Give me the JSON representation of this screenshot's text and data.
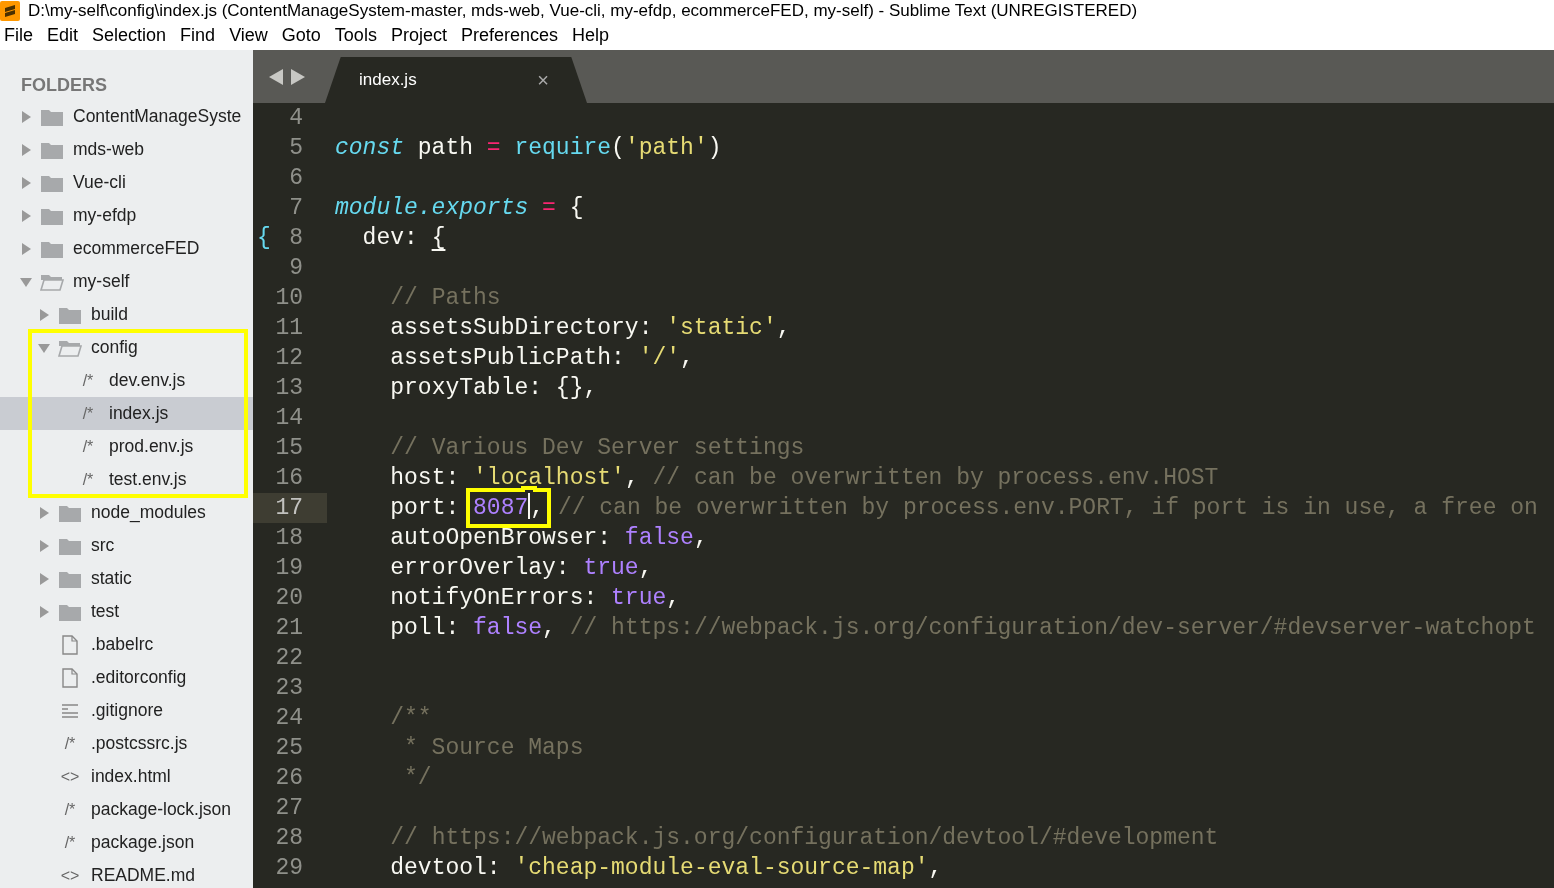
{
  "window": {
    "title": "D:\\my-self\\config\\index.js (ContentManageSystem-master, mds-web, Vue-cli, my-efdp, ecommerceFED, my-self) - Sublime Text (UNREGISTERED)"
  },
  "menu": [
    "File",
    "Edit",
    "Selection",
    "Find",
    "View",
    "Goto",
    "Tools",
    "Project",
    "Preferences",
    "Help"
  ],
  "sidebar": {
    "heading": "FOLDERS",
    "items": [
      {
        "label": "ContentManageSyste",
        "kind": "folder",
        "expanded": false,
        "selected": false
      },
      {
        "label": "mds-web",
        "kind": "folder",
        "expanded": false,
        "selected": false
      },
      {
        "label": "Vue-cli",
        "kind": "folder",
        "expanded": false,
        "selected": false
      },
      {
        "label": "my-efdp",
        "kind": "folder",
        "expanded": false,
        "selected": false
      },
      {
        "label": "ecommerceFED",
        "kind": "folder",
        "expanded": false,
        "selected": false
      },
      {
        "label": "my-self",
        "kind": "folder",
        "expanded": true,
        "selected": false,
        "children": [
          {
            "label": "build",
            "kind": "folder",
            "expanded": false,
            "selected": false
          },
          {
            "label": "config",
            "kind": "folder",
            "expanded": true,
            "selected": false,
            "boxed": true,
            "children": [
              {
                "label": "dev.env.js",
                "kind": "glyph",
                "glyph": "/*",
                "selected": false
              },
              {
                "label": "index.js",
                "kind": "glyph",
                "glyph": "/*",
                "selected": true
              },
              {
                "label": "prod.env.js",
                "kind": "glyph",
                "glyph": "/*",
                "selected": false
              },
              {
                "label": "test.env.js",
                "kind": "glyph",
                "glyph": "/*",
                "selected": false
              }
            ]
          },
          {
            "label": "node_modules",
            "kind": "folder",
            "expanded": false,
            "selected": false
          },
          {
            "label": "src",
            "kind": "folder",
            "expanded": false,
            "selected": false
          },
          {
            "label": "static",
            "kind": "folder",
            "expanded": false,
            "selected": false
          },
          {
            "label": "test",
            "kind": "folder",
            "expanded": false,
            "selected": false
          },
          {
            "label": ".babelrc",
            "kind": "doc",
            "selected": false
          },
          {
            "label": ".editorconfig",
            "kind": "doc",
            "selected": false
          },
          {
            "label": ".gitignore",
            "kind": "lines",
            "selected": false
          },
          {
            "label": ".postcssrc.js",
            "kind": "glyph",
            "glyph": "/*",
            "selected": false
          },
          {
            "label": "index.html",
            "kind": "glyph",
            "glyph": "<>",
            "selected": false
          },
          {
            "label": "package-lock.json",
            "kind": "glyph",
            "glyph": "/*",
            "selected": false
          },
          {
            "label": "package.json",
            "kind": "glyph",
            "glyph": "/*",
            "selected": false
          },
          {
            "label": "README.md",
            "kind": "glyph",
            "glyph": "<>",
            "selected": false
          }
        ]
      }
    ]
  },
  "tabs": [
    {
      "label": "index.js",
      "close": "×",
      "selected": true
    }
  ],
  "editor": {
    "lines": [
      {
        "number": "4",
        "current": false
      },
      {
        "number": "5",
        "current": false,
        "tokens": [
          {
            "kind": "keyword",
            "text": "const"
          },
          {
            "kind": "plain",
            "text": " path "
          },
          {
            "kind": "operator",
            "text": "= "
          },
          {
            "kind": "function",
            "text": "require"
          },
          {
            "kind": "plain",
            "text": "("
          },
          {
            "kind": "string",
            "text": "'path'"
          },
          {
            "kind": "plain",
            "text": ")"
          }
        ]
      },
      {
        "number": "6",
        "current": false
      },
      {
        "number": "7",
        "current": false,
        "tokens": [
          {
            "kind": "keyword",
            "text": "module.exports"
          },
          {
            "kind": "operator",
            "text": " ="
          },
          {
            "kind": "plain",
            "text": " {"
          }
        ]
      },
      {
        "number": "8",
        "current": false,
        "gutter_mark": "{",
        "tokens": [
          {
            "kind": "plain",
            "text": "  dev: "
          },
          {
            "kind": "bracket",
            "text": "{"
          }
        ]
      },
      {
        "number": "9",
        "current": false
      },
      {
        "number": "10",
        "current": false,
        "tokens": [
          {
            "kind": "comment",
            "text": "    // Paths"
          }
        ]
      },
      {
        "number": "11",
        "current": false,
        "tokens": [
          {
            "kind": "plain",
            "text": "    assetsSubDirectory: "
          },
          {
            "kind": "string",
            "text": "'static'"
          },
          {
            "kind": "plain",
            "text": ","
          }
        ]
      },
      {
        "number": "12",
        "current": false,
        "tokens": [
          {
            "kind": "plain",
            "text": "    assetsPublicPath: "
          },
          {
            "kind": "string",
            "text": "'/'"
          },
          {
            "kind": "plain",
            "text": ","
          }
        ]
      },
      {
        "number": "13",
        "current": false,
        "tokens": [
          {
            "kind": "plain",
            "text": "    proxyTable: {},"
          }
        ]
      },
      {
        "number": "14",
        "current": false
      },
      {
        "number": "15",
        "current": false,
        "tokens": [
          {
            "kind": "comment",
            "text": "    // Various Dev Server settings"
          }
        ]
      },
      {
        "number": "16",
        "current": false,
        "tokens": [
          {
            "kind": "plain",
            "text": "    host: "
          },
          {
            "kind": "string",
            "text": "'localhost'"
          },
          {
            "kind": "plain",
            "text": ", "
          },
          {
            "kind": "comment",
            "text": "// can be overwritten by process.env.HOST"
          }
        ]
      },
      {
        "number": "17",
        "current": true,
        "tokens": [
          {
            "kind": "plain",
            "text": "    port: "
          },
          {
            "kind": "constant",
            "text": "8087",
            "boxed": true,
            "caret": true
          },
          {
            "kind": "plain",
            "text": ",",
            "boxed": true
          },
          {
            "kind": "comment",
            "text": " // can be overwritten by process.env.PORT, if port is in use, a free on"
          }
        ]
      },
      {
        "number": "18",
        "current": false,
        "tokens": [
          {
            "kind": "plain",
            "text": "    autoOpenBrowser: "
          },
          {
            "kind": "constant",
            "text": "false"
          },
          {
            "kind": "plain",
            "text": ","
          }
        ]
      },
      {
        "number": "19",
        "current": false,
        "tokens": [
          {
            "kind": "plain",
            "text": "    errorOverlay: "
          },
          {
            "kind": "constant",
            "text": "true"
          },
          {
            "kind": "plain",
            "text": ","
          }
        ]
      },
      {
        "number": "20",
        "current": false,
        "tokens": [
          {
            "kind": "plain",
            "text": "    notifyOnErrors: "
          },
          {
            "kind": "constant",
            "text": "true"
          },
          {
            "kind": "plain",
            "text": ","
          }
        ]
      },
      {
        "number": "21",
        "current": false,
        "tokens": [
          {
            "kind": "plain",
            "text": "    poll: "
          },
          {
            "kind": "constant",
            "text": "false"
          },
          {
            "kind": "plain",
            "text": ", "
          },
          {
            "kind": "comment",
            "text": "// https://webpack.js.org/configuration/dev-server/#devserver-watchopt"
          }
        ]
      },
      {
        "number": "22",
        "current": false
      },
      {
        "number": "23",
        "current": false
      },
      {
        "number": "24",
        "current": false,
        "tokens": [
          {
            "kind": "comment",
            "text": "    /**"
          }
        ]
      },
      {
        "number": "25",
        "current": false,
        "tokens": [
          {
            "kind": "comment",
            "text": "     * Source Maps"
          }
        ]
      },
      {
        "number": "26",
        "current": false,
        "tokens": [
          {
            "kind": "comment",
            "text": "     */"
          }
        ]
      },
      {
        "number": "27",
        "current": false
      },
      {
        "number": "28",
        "current": false,
        "tokens": [
          {
            "kind": "comment",
            "text": "    // https://webpack.js.org/configuration/devtool/#development"
          }
        ]
      },
      {
        "number": "29",
        "current": false,
        "tokens": [
          {
            "kind": "plain",
            "text": "    devtool: "
          },
          {
            "kind": "string",
            "text": "'cheap-module-eval-source-map'"
          },
          {
            "kind": "plain",
            "text": ","
          }
        ]
      }
    ]
  }
}
